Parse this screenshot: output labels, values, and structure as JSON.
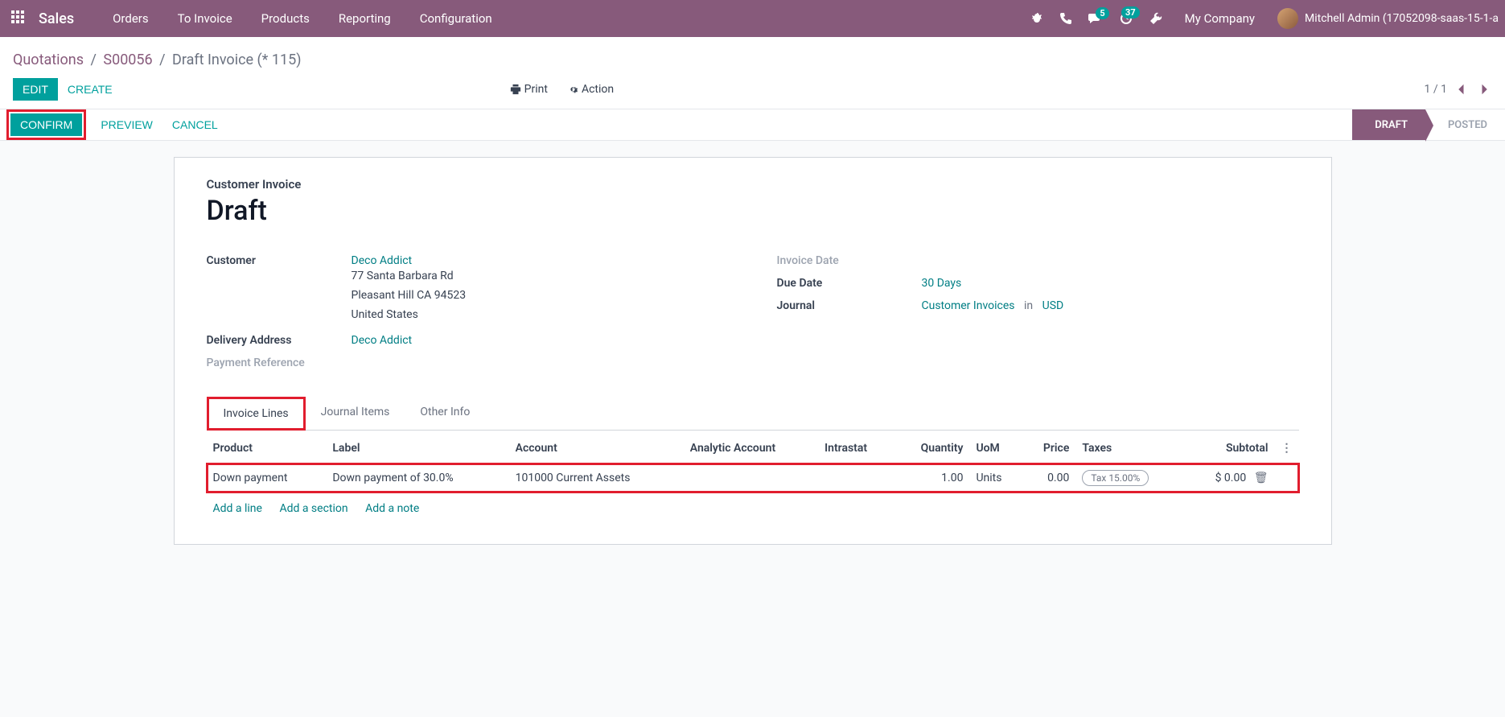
{
  "nav": {
    "brand": "Sales",
    "items": [
      "Orders",
      "To Invoice",
      "Products",
      "Reporting",
      "Configuration"
    ],
    "message_badge": "5",
    "activity_badge": "37",
    "company": "My Company",
    "user": "Mitchell Admin (17052098-saas-15-1-a"
  },
  "breadcrumb": {
    "p1": "Quotations",
    "p2": "S00056",
    "p3": "Draft Invoice (* 115)"
  },
  "control": {
    "edit": "EDIT",
    "create": "CREATE",
    "print": "Print",
    "action": "Action",
    "pager": "1 / 1"
  },
  "statusbar": {
    "confirm": "CONFIRM",
    "preview": "PREVIEW",
    "cancel": "CANCEL",
    "draft": "DRAFT",
    "posted": "POSTED"
  },
  "doc": {
    "type": "Customer Invoice",
    "title": "Draft",
    "labels": {
      "customer": "Customer",
      "delivery": "Delivery Address",
      "payref": "Payment Reference",
      "invdate": "Invoice Date",
      "duedate": "Due Date",
      "journal": "Journal"
    },
    "customer_name": "Deco Addict",
    "addr1": "77 Santa Barbara Rd",
    "addr2": "Pleasant Hill CA 94523",
    "addr3": "United States",
    "delivery_value": "Deco Addict",
    "duedate_value": "30 Days",
    "journal_value": "Customer Invoices",
    "journal_in": "in",
    "journal_currency": "USD"
  },
  "tabs": {
    "invoice_lines": "Invoice Lines",
    "journal_items": "Journal Items",
    "other_info": "Other Info"
  },
  "table": {
    "headers": {
      "product": "Product",
      "label": "Label",
      "account": "Account",
      "analytic": "Analytic Account",
      "intrastat": "Intrastat",
      "quantity": "Quantity",
      "uom": "UoM",
      "price": "Price",
      "taxes": "Taxes",
      "subtotal": "Subtotal"
    },
    "row": {
      "product": "Down payment",
      "label": "Down payment of 30.0%",
      "account": "101000 Current Assets",
      "analytic": "",
      "intrastat": "",
      "quantity": "1.00",
      "uom": "Units",
      "price": "0.00",
      "taxes": "Tax 15.00%",
      "subtotal": "$ 0.00"
    },
    "add_line": "Add a line",
    "add_section": "Add a section",
    "add_note": "Add a note"
  }
}
